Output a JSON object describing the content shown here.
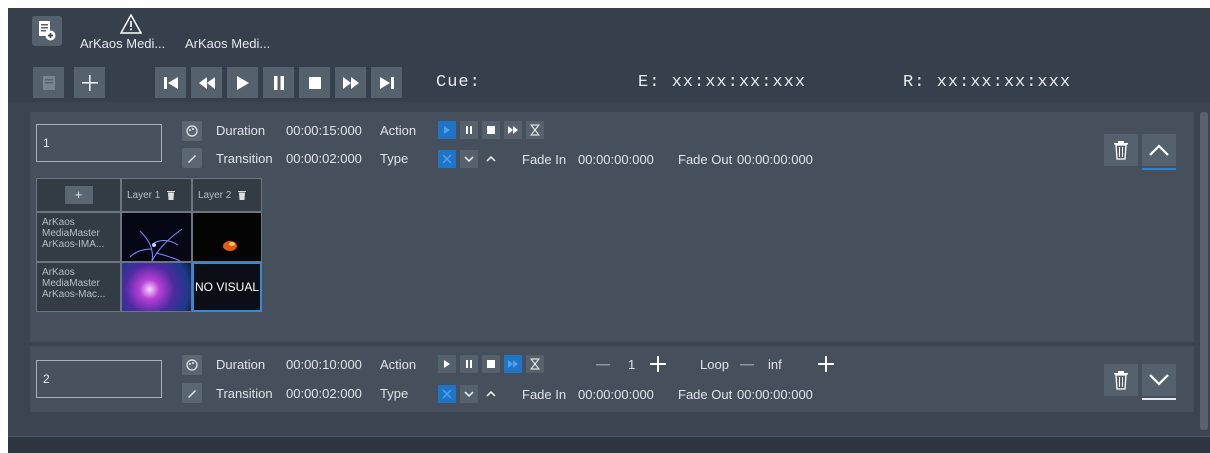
{
  "tabs": [
    {
      "label": "ArKaos Medi..."
    },
    {
      "label": "ArKaos Medi..."
    }
  ],
  "transport": {
    "cue_label": "Cue:",
    "elapsed": "E: xx:xx:xx:xxx",
    "remaining": "R: xx:xx:xx:xxx"
  },
  "cues": [
    {
      "number": "1",
      "duration_label": "Duration",
      "duration": "00:00:15:000",
      "action_label": "Action",
      "transition_label": "Transition",
      "transition": "00:00:02:000",
      "type_label": "Type",
      "fade_in_label": "Fade In",
      "fade_in": "00:00:00:000",
      "fade_out_label": "Fade Out",
      "fade_out": "00:00:00:000",
      "layers": {
        "add_label": "+",
        "columns": [
          "Layer 1",
          "Layer 2"
        ],
        "rows": [
          {
            "label": "ArKaos MediaMaster ArKaos-IMA...",
            "cells": [
              "image",
              "image"
            ]
          },
          {
            "label": "ArKaos MediaMaster ArKaos-Mac...",
            "cells": [
              "image",
              "NO VISUAL"
            ]
          }
        ]
      }
    },
    {
      "number": "2",
      "duration_label": "Duration",
      "duration": "00:00:10:000",
      "action_label": "Action",
      "transition_label": "Transition",
      "transition": "00:00:02:000",
      "type_label": "Type",
      "fade_in_label": "Fade In",
      "fade_in": "00:00:00:000",
      "fade_out_label": "Fade Out",
      "fade_out": "00:00:00:000",
      "repeat_value": "1",
      "loop_label": "Loop",
      "loop_value": "inf"
    }
  ],
  "colors": {
    "accent": "#1f74c5",
    "background": "#3b4552",
    "panel": "#46505c"
  }
}
